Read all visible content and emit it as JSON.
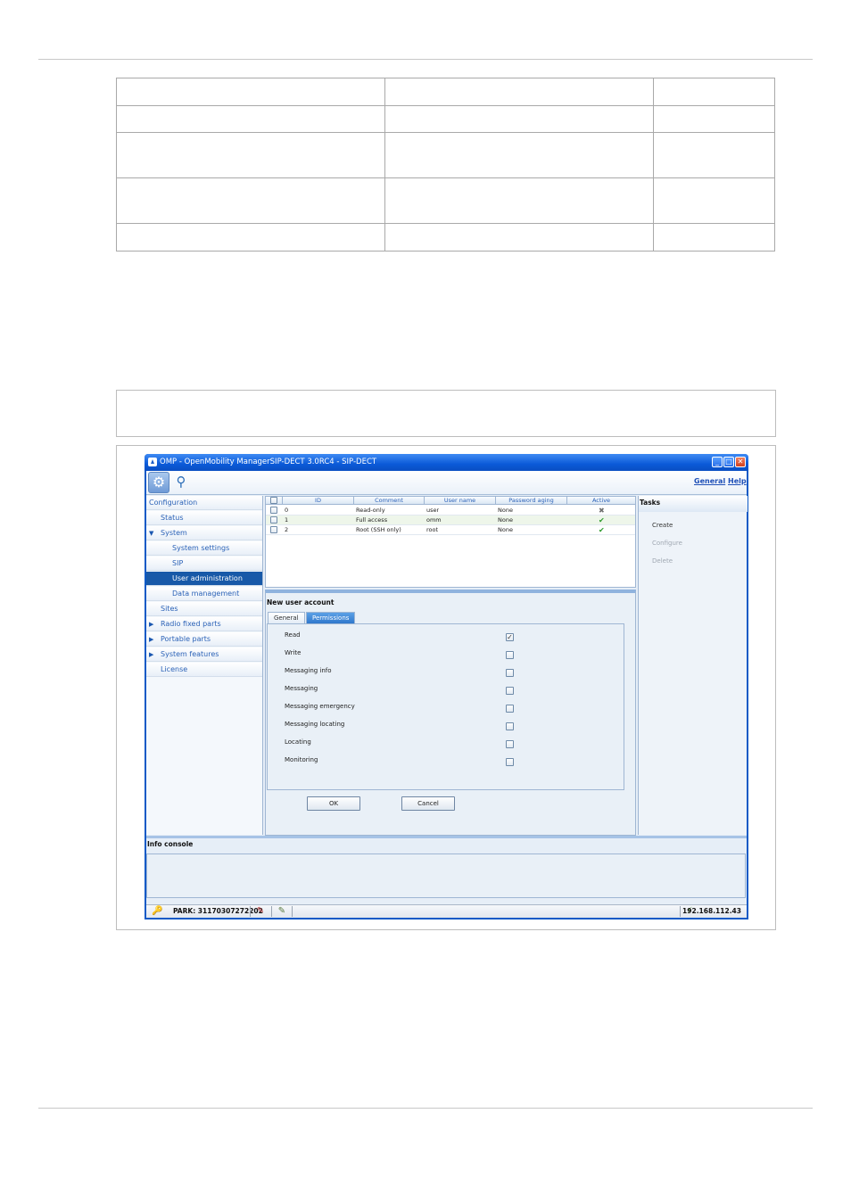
{
  "window": {
    "title": "OMP - OpenMobility ManagerSIP-DECT 3.0RC4 - SIP-DECT"
  },
  "toolbar": {
    "general_link": "General",
    "help_link": "Help"
  },
  "nav": {
    "items": [
      {
        "label": "Configuration"
      },
      {
        "label": "Status"
      },
      {
        "label": "System"
      },
      {
        "label": "System settings"
      },
      {
        "label": "SIP"
      },
      {
        "label": "User administration"
      },
      {
        "label": "Data management"
      },
      {
        "label": "Sites"
      },
      {
        "label": "Radio fixed parts"
      },
      {
        "label": "Portable parts"
      },
      {
        "label": "System features"
      },
      {
        "label": "License"
      }
    ]
  },
  "grid": {
    "columns": [
      "ID",
      "Comment",
      "User name",
      "Password aging",
      "Active"
    ],
    "rows": [
      {
        "id": "0",
        "comment": "Read-only",
        "user": "user",
        "aging": "None",
        "active": "✖"
      },
      {
        "id": "1",
        "comment": "Full access",
        "user": "omm",
        "aging": "None",
        "active": "✔"
      },
      {
        "id": "2",
        "comment": "Root (SSH only)",
        "user": "root",
        "aging": "None",
        "active": "✔"
      }
    ]
  },
  "tasks": {
    "title": "Tasks",
    "items": [
      "Create",
      "Configure",
      "Delete"
    ]
  },
  "form": {
    "title": "New user account",
    "tabs": [
      "General",
      "Permissions"
    ],
    "permissions": [
      {
        "label": "Read",
        "check": "✓"
      },
      {
        "label": "Write",
        "check": ""
      },
      {
        "label": "Messaging info",
        "check": ""
      },
      {
        "label": "Messaging",
        "check": ""
      },
      {
        "label": "Messaging emergency",
        "check": ""
      },
      {
        "label": "Messaging locating",
        "check": ""
      },
      {
        "label": "Locating",
        "check": ""
      },
      {
        "label": "Monitoring",
        "check": ""
      }
    ],
    "ok_label": "OK",
    "cancel_label": "Cancel"
  },
  "console": {
    "title": "Info console"
  },
  "status": {
    "park": "PARK: 31170307272202",
    "ip": "192.168.112.43"
  }
}
